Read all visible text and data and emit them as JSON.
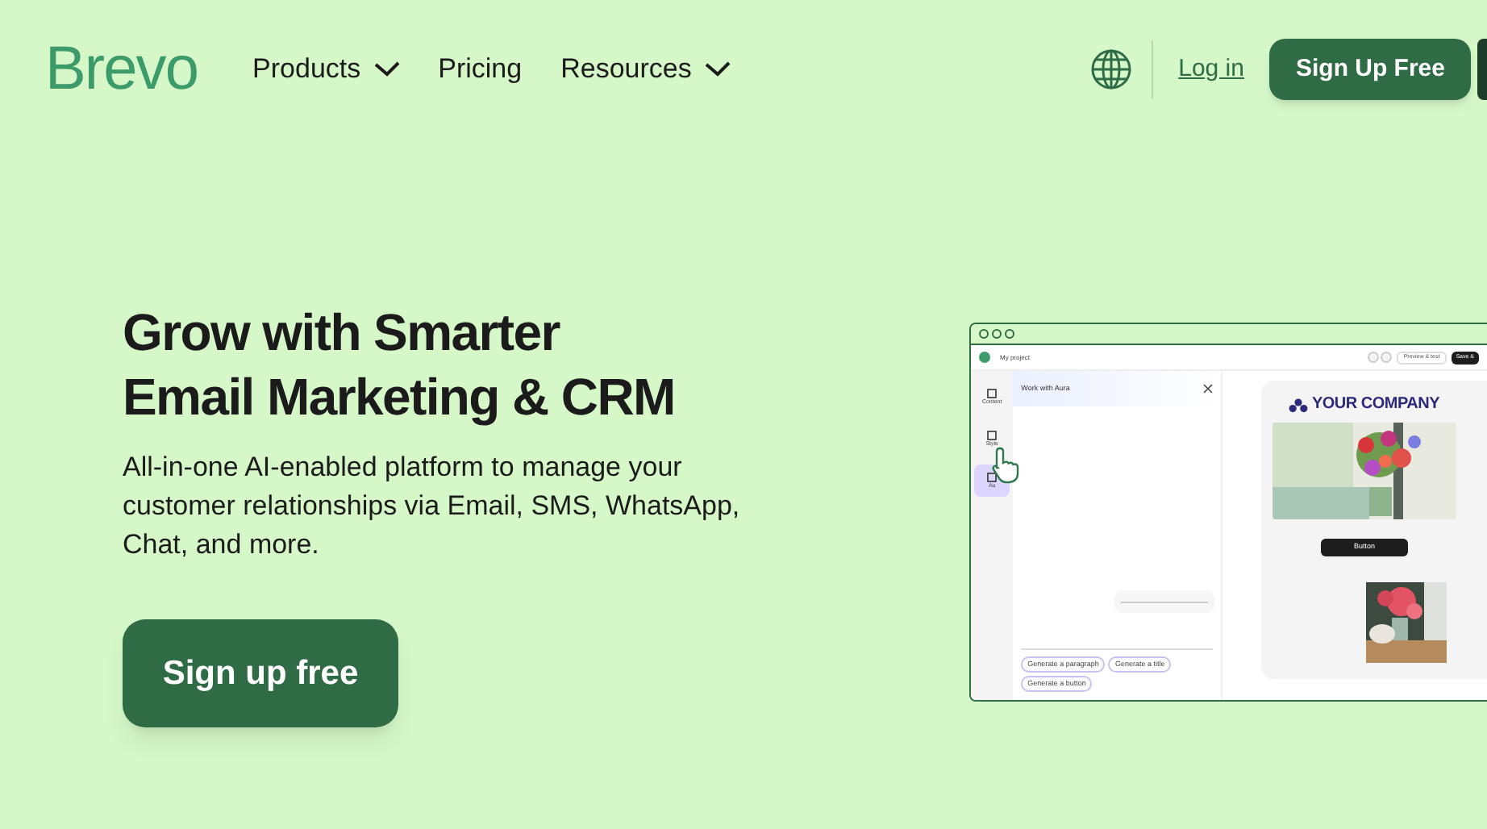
{
  "header": {
    "logo": "Brevo",
    "nav": [
      {
        "label": "Products",
        "dropdown": true
      },
      {
        "label": "Pricing",
        "dropdown": false
      },
      {
        "label": "Resources",
        "dropdown": true
      }
    ],
    "login": "Log in",
    "signup": "Sign Up Free"
  },
  "hero": {
    "title_lines": [
      "Grow with Smarter",
      "Email Marketing & CRM"
    ],
    "text": "All-in-one AI-enabled platform to manage your customer relationships via Email, SMS, WhatsApp, Chat, and more.",
    "button": "Sign up free"
  },
  "mockup": {
    "project": "My project",
    "actions": [
      {
        "label": "Preview & test",
        "kind": "outline"
      },
      {
        "label": "Save &",
        "kind": "solid"
      }
    ],
    "rail": [
      {
        "label": "Content",
        "selected": false
      },
      {
        "label": "Style",
        "selected": false
      },
      {
        "label": "Au",
        "selected": true
      }
    ],
    "panel_title": "Work with Aura",
    "suggestions": [
      "Generate a paragraph",
      "Generate a title",
      "Generate a button"
    ],
    "company": "YOUR COMPANY",
    "email_button": "Button"
  }
}
